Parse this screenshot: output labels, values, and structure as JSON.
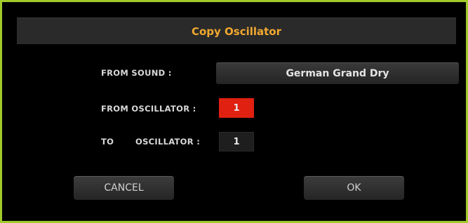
{
  "dialog": {
    "title": "Copy Oscillator"
  },
  "from_sound": {
    "label": "FROM SOUND :",
    "value": "German Grand Dry"
  },
  "from_oscillator": {
    "label": "FROM  OSCILLATOR :",
    "value": "1",
    "highlight_color": "#e02010"
  },
  "to_oscillator": {
    "label_to": "TO",
    "label_oscillator": "OSCILLATOR :",
    "value": "1"
  },
  "buttons": {
    "cancel": "CANCEL",
    "ok": "OK"
  },
  "colors": {
    "frame_border": "#a2ca2a",
    "title_text": "#f0a830",
    "background": "#000000"
  }
}
